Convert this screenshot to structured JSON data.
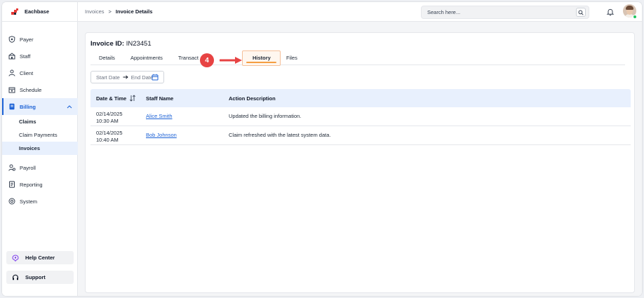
{
  "brand": {
    "name": "Eachbase"
  },
  "sidebar": {
    "items": [
      {
        "label": "Payer",
        "icon": "shield-icon"
      },
      {
        "label": "Staff",
        "icon": "staff-icon"
      },
      {
        "label": "Client",
        "icon": "client-icon"
      },
      {
        "label": "Schedule",
        "icon": "calendar-icon"
      },
      {
        "label": "Billing",
        "icon": "billing-icon"
      },
      {
        "label": "Payroll",
        "icon": "payroll-icon"
      },
      {
        "label": "Reporting",
        "icon": "report-icon"
      },
      {
        "label": "System",
        "icon": "system-icon"
      }
    ],
    "billing_sub": [
      {
        "label": "Claims"
      },
      {
        "label": "Claim Payments"
      },
      {
        "label": "Invoices"
      }
    ],
    "help_label": "Help Center",
    "support_label": "Support"
  },
  "topbar": {
    "breadcrumb_parent": "Invoices",
    "breadcrumb_separator": ">",
    "breadcrumb_current": "Invoice Details",
    "search_placeholder": "Search here..."
  },
  "invoice": {
    "id_label": "Invoice ID:",
    "id_value": "IN23451"
  },
  "tabs": [
    {
      "label": "Details"
    },
    {
      "label": "Appointments"
    },
    {
      "label": "Transact"
    },
    {
      "label": "History"
    },
    {
      "label": "Files"
    }
  ],
  "callout": {
    "step": "4"
  },
  "filter": {
    "start_placeholder": "Start Date",
    "end_placeholder": "End Date"
  },
  "table": {
    "headers": [
      "Date & Time",
      "Staff Name",
      "Action Description"
    ],
    "rows": [
      {
        "date": "02/14/2025",
        "time": "10:30 AM",
        "staff": "Alice Smith",
        "action": "Updated the billing information."
      },
      {
        "date": "02/14/2025",
        "time": "10:40 AM",
        "staff": "Bob Johnson",
        "action": "Claim refreshed with the latest system data."
      }
    ]
  },
  "colors": {
    "accent": "#1e63d6",
    "highlight": "#f59e42",
    "callout": "#e74343",
    "online": "#22c55e"
  }
}
